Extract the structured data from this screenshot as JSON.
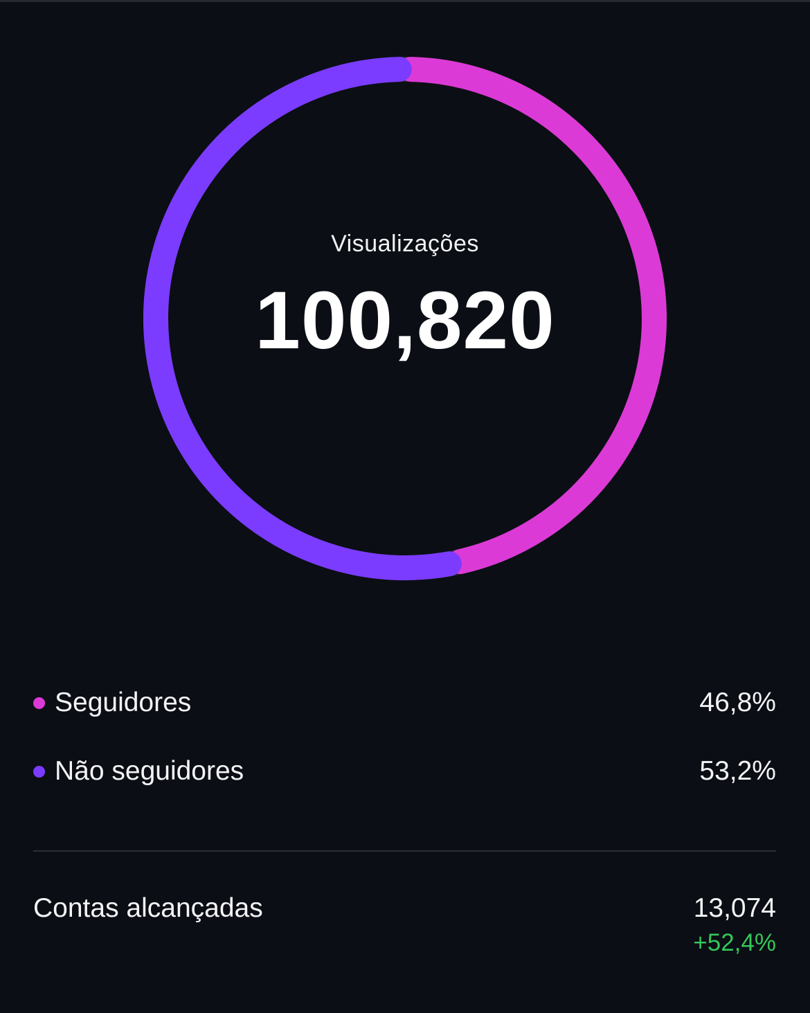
{
  "views": {
    "label": "Visualizações",
    "total": "100,820"
  },
  "chart_data": {
    "type": "pie",
    "series": [
      {
        "name": "Seguidores",
        "value": 46.8,
        "color": "#dc3ad6"
      },
      {
        "name": "Não seguidores",
        "value": 53.2,
        "color": "#7b3cff"
      }
    ]
  },
  "legend": [
    {
      "label": "Seguidores",
      "value": "46,8%",
      "color": "#dc3ad6"
    },
    {
      "label": "Não seguidores",
      "value": "53,2%",
      "color": "#7b3cff"
    }
  ],
  "reach": {
    "label": "Contas alcançadas",
    "value": "13,074",
    "change": "+52,4%",
    "change_color": "#34c759"
  }
}
